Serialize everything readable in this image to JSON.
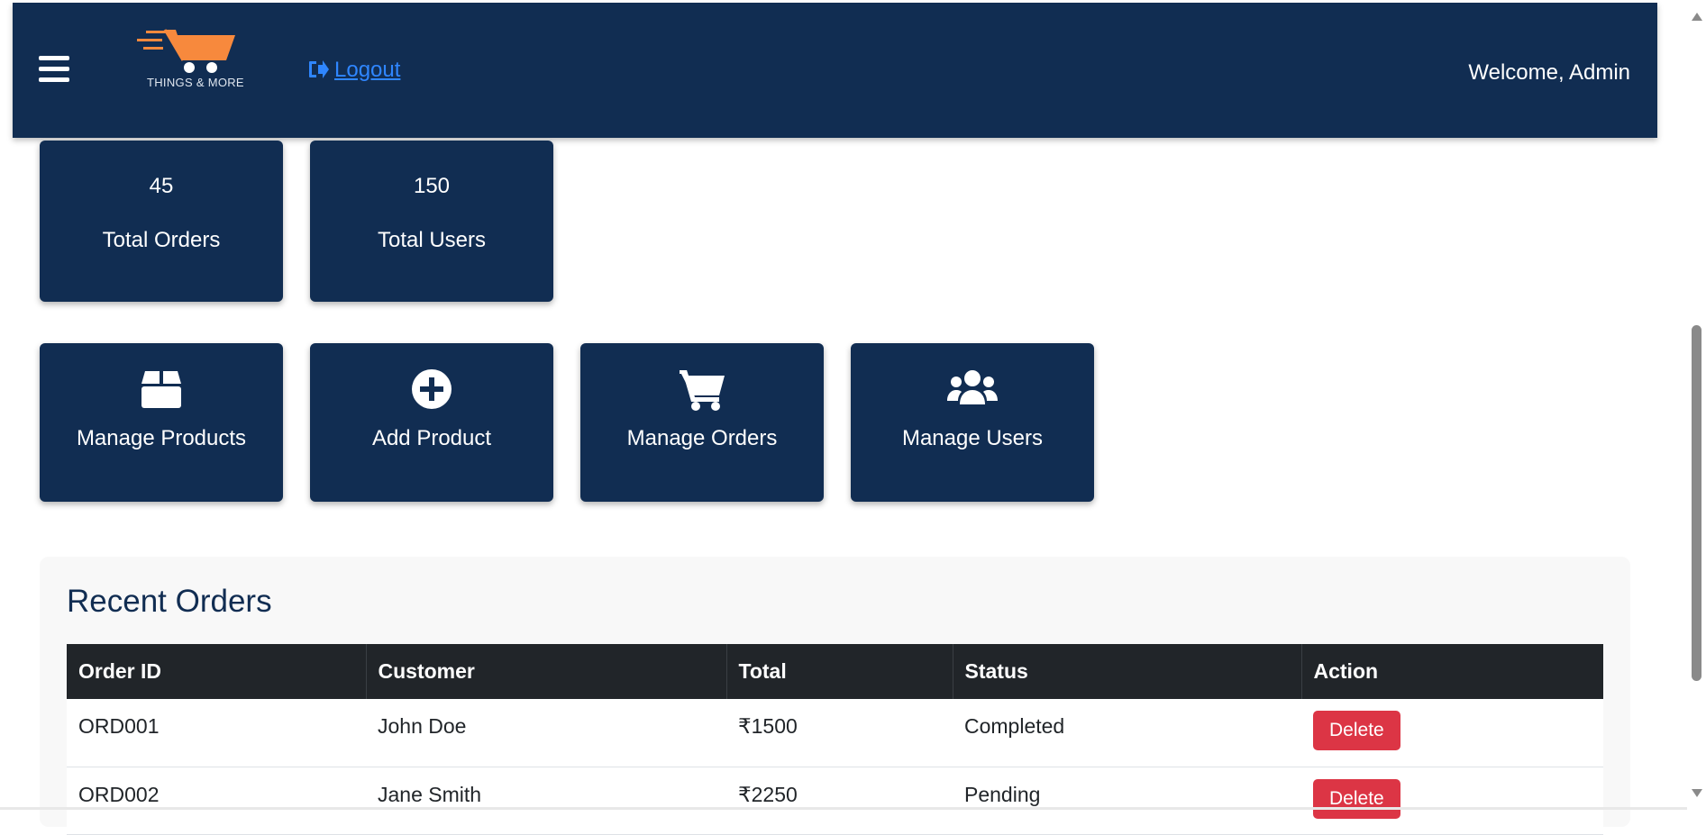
{
  "header": {
    "logo_text": "THINGS & MORE",
    "logout_label": "Logout",
    "welcome_text": "Welcome, Admin"
  },
  "stats": [
    {
      "value": "45",
      "label": "Total Orders"
    },
    {
      "value": "150",
      "label": "Total Users"
    }
  ],
  "actions": [
    {
      "label": "Manage Products",
      "icon": "box-icon"
    },
    {
      "label": "Add Product",
      "icon": "plus-circle-icon"
    },
    {
      "label": "Manage Orders",
      "icon": "cart-icon"
    },
    {
      "label": "Manage Users",
      "icon": "users-icon"
    }
  ],
  "recent_orders": {
    "title": "Recent Orders",
    "columns": [
      "Order ID",
      "Customer",
      "Total",
      "Status",
      "Action"
    ],
    "rows": [
      {
        "order_id": "ORD001",
        "customer": "John Doe",
        "total": "₹1500",
        "status": "Completed",
        "action": "Delete"
      },
      {
        "order_id": "ORD002",
        "customer": "Jane Smith",
        "total": "₹2250",
        "status": "Pending",
        "action": "Delete"
      }
    ]
  },
  "colors": {
    "navbar": "#112d52",
    "card": "#112d52",
    "link": "#2f86ff",
    "delete_button": "#dc3545",
    "table_header": "#212529",
    "logo_accent": "#f7893d"
  }
}
